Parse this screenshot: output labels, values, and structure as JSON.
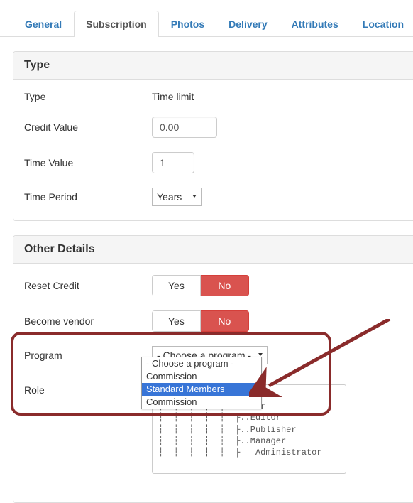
{
  "tabs": {
    "general": "General",
    "subscription": "Subscription",
    "photos": "Photos",
    "delivery": "Delivery",
    "attributes": "Attributes",
    "location": "Location"
  },
  "type_panel": {
    "heading": "Type",
    "rows": {
      "type_label": "Type",
      "type_value": "Time limit",
      "credit_label": "Credit Value",
      "credit_value": "0.00",
      "time_value_label": "Time Value",
      "time_value": "1",
      "time_period_label": "Time Period",
      "time_period_value": "Years"
    }
  },
  "other_panel": {
    "heading": "Other Details",
    "reset_credit_label": "Reset Credit",
    "become_vendor_label": "Become vendor",
    "yes": "Yes",
    "no": "No",
    "program_label": "Program",
    "program_selected": "- Choose a program -",
    "program_options": {
      "o0": "- Choose a program -",
      "o1": "Commission",
      "o2": "Standard Members",
      "o3": "Commission"
    },
    "role_label": "Role",
    "role_tree": "┆  ┆  ┆  ┆…Registered\n┆  ┆  ┆  ┆  ├..Author\n┆  ┆  ┆  ┆  ┆  ├..Editor\n┆  ┆  ┆  ┆  ┆  ├..Publisher\n┆  ┆  ┆  ┆  ┆  ├..Manager\n┆  ┆  ┆  ┆  ┆  ├   Administrator"
  }
}
